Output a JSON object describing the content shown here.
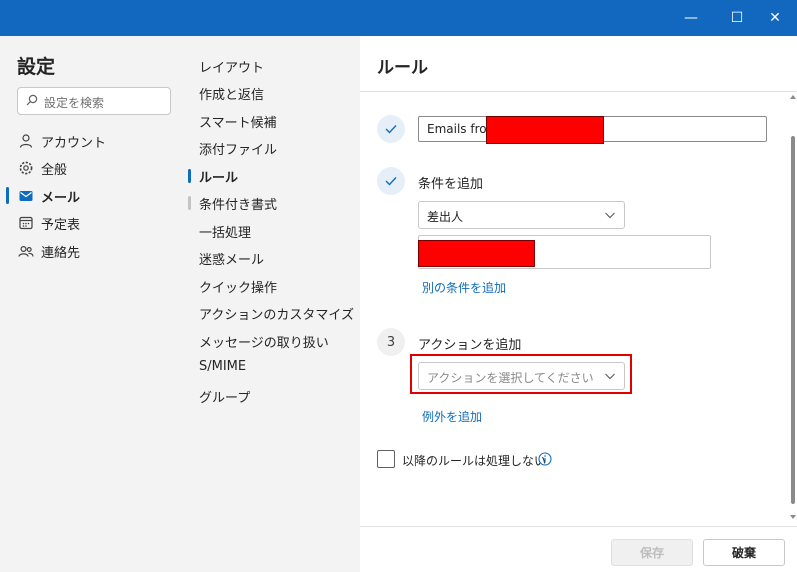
{
  "window": {
    "minimize_glyph": "—",
    "maximize_glyph": "☐",
    "close_glyph": "✕"
  },
  "settings": {
    "title": "設定",
    "search_placeholder": "設定を検索",
    "nav": [
      {
        "label": "アカウント",
        "icon": "person-icon"
      },
      {
        "label": "全般",
        "icon": "gear-icon"
      },
      {
        "label": "メール",
        "icon": "mail-icon",
        "active": true
      },
      {
        "label": "予定表",
        "icon": "calendar-icon"
      },
      {
        "label": "連絡先",
        "icon": "people-icon"
      }
    ]
  },
  "mail_settings": {
    "items": [
      {
        "label": "レイアウト"
      },
      {
        "label": "作成と返信"
      },
      {
        "label": "スマート候補"
      },
      {
        "label": "添付ファイル"
      },
      {
        "label": "ルール",
        "active": true
      },
      {
        "label": "条件付き書式"
      },
      {
        "label": "一括処理"
      },
      {
        "label": "迷惑メール"
      },
      {
        "label": "クイック操作"
      },
      {
        "label": "アクションのカスタマイズ"
      },
      {
        "label": "メッセージの取り扱い"
      },
      {
        "label": "S/MIME"
      },
      {
        "label": "グループ"
      }
    ]
  },
  "rule": {
    "title": "ルール",
    "name_value": "Emails from",
    "step3_number": "3",
    "condition_label": "条件を追加",
    "condition_select": "差出人",
    "add_condition_link": "別の条件を追加",
    "action_label": "アクションを追加",
    "action_placeholder": "アクションを選択してください",
    "add_exception_link": "例外を追加",
    "stop_processing_label": "以降のルールは処理しない"
  },
  "footer": {
    "save": "保存",
    "discard": "破棄"
  },
  "colors": {
    "titlebar": "#1268bf",
    "accent": "#0f6cbd",
    "redaction": "#ff0000",
    "highlight_border": "#e00000"
  }
}
